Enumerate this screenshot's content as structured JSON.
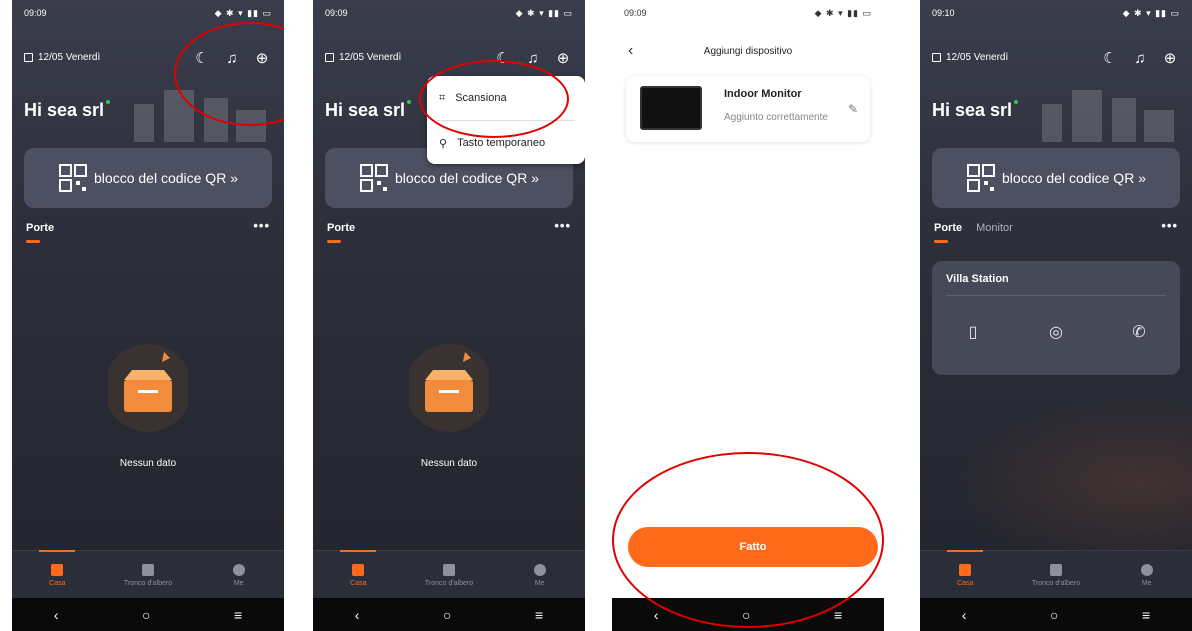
{
  "status": {
    "time1": "09:09",
    "time2": "09:09",
    "time3": "09:09",
    "time4": "09:10"
  },
  "home": {
    "date": "12/05 Venerdì",
    "greeting": "Hi sea srl",
    "qr_label": "blocco del codice QR »",
    "tab_doors": "Porte",
    "tab_monitor": "Monitor",
    "empty": "Nessun dato"
  },
  "menu": {
    "scan": "Scansiona",
    "temp_key": "Tasto temporaneo"
  },
  "nav": {
    "home": "Casa",
    "tree": "Tronco d'albero",
    "me": "Me"
  },
  "add_device": {
    "title": "Aggiungi dispositivo",
    "device_name": "Indoor Monitor",
    "device_status": "Aggiunto correttamente",
    "done": "Fatto"
  },
  "villa": {
    "title": "Villa Station"
  },
  "colors": {
    "accent": "#ff6a1a",
    "annotation": "#e00000",
    "online": "#2ecc40"
  },
  "icons": [
    "moon-icon",
    "bell-icon",
    "plus-circle-icon",
    "qr-icon",
    "scan-icon",
    "search-key-icon",
    "back-icon",
    "edit-icon",
    "door-icon",
    "camera-icon",
    "phone-icon"
  ]
}
